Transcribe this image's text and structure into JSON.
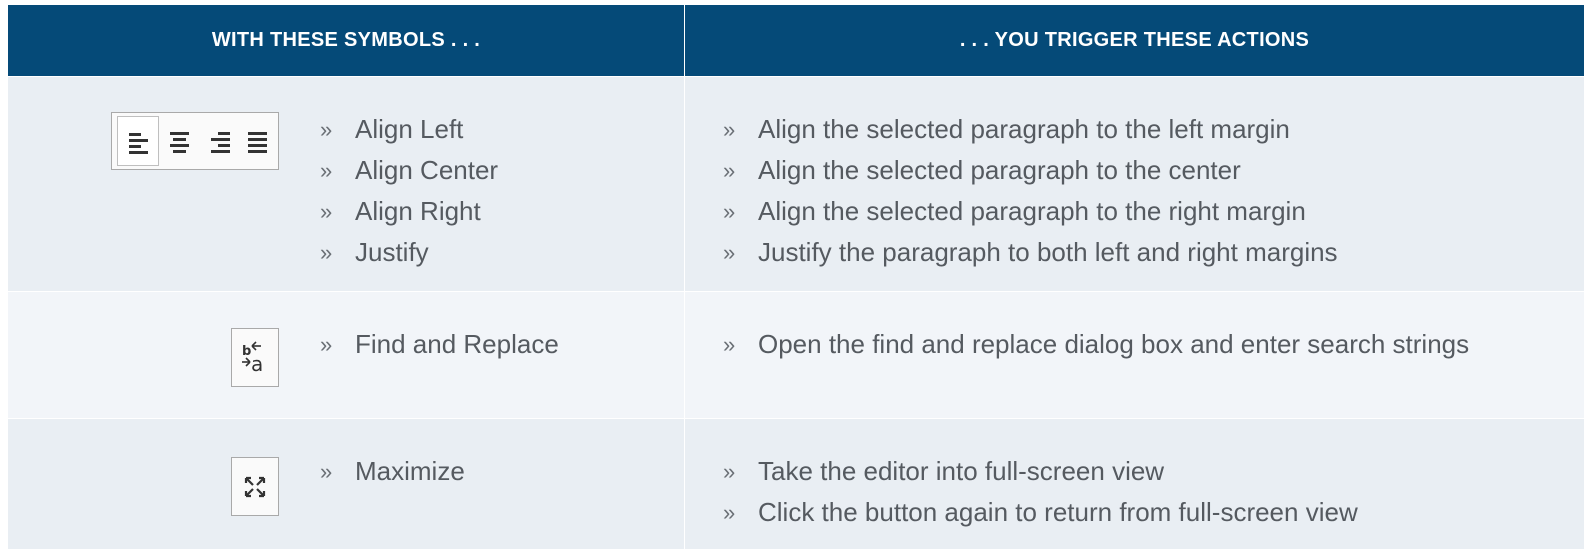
{
  "header": {
    "symbols_label": "WITH THESE SYMBOLS . . .",
    "actions_label": ". . . YOU TRIGGER THESE ACTIONS"
  },
  "bullet": "»",
  "colors": {
    "header_bg": "#054a78",
    "row_dark": "#e9eef3",
    "row_light": "#f2f5f9",
    "text": "#555a60"
  },
  "rows": [
    {
      "icons": [
        "align-left-icon",
        "align-center-icon",
        "align-right-icon",
        "justify-icon"
      ],
      "symbols": [
        "Align Left",
        "Align Center",
        "Align Right",
        "Justify"
      ],
      "actions": [
        "Align the selected paragraph to the left margin",
        "Align the selected paragraph to the center",
        "Align the selected paragraph to the right margin",
        "Justify the paragraph to both left and right margins"
      ]
    },
    {
      "icons": [
        "find-replace-icon"
      ],
      "symbols": [
        "Find and Replace"
      ],
      "actions": [
        "Open the find and replace dialog box and enter search strings"
      ]
    },
    {
      "icons": [
        "maximize-icon"
      ],
      "symbols": [
        "Maximize"
      ],
      "actions": [
        "Take the editor into full-screen view",
        "Click the button again to return from full-screen view"
      ]
    }
  ]
}
